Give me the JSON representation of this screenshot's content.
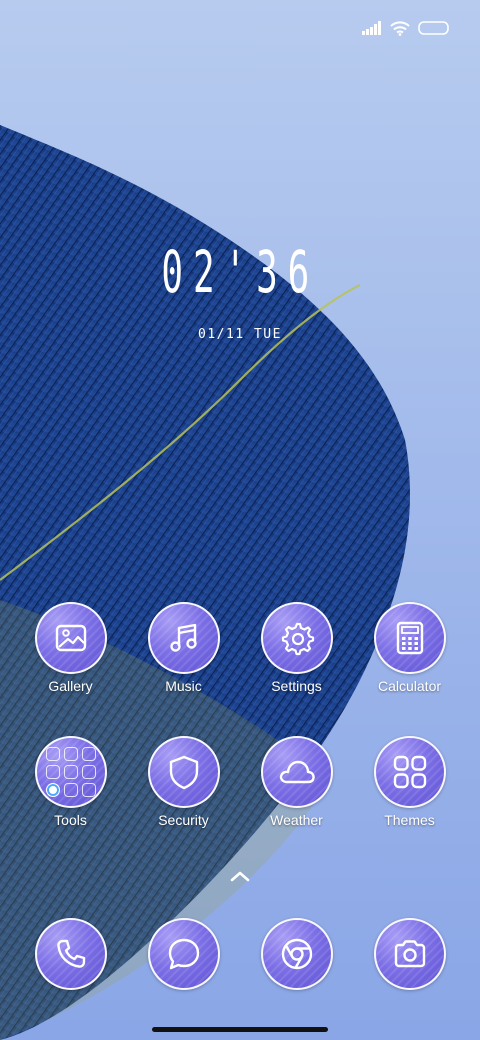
{
  "status_bar": {
    "icons": [
      "signal-icon",
      "wifi-icon",
      "battery-icon"
    ]
  },
  "lock": {
    "time": "02'36",
    "date": "01/11 TUE"
  },
  "apps": [
    {
      "label": "Gallery",
      "icon": "gallery-icon"
    },
    {
      "label": "Music",
      "icon": "music-icon"
    },
    {
      "label": "Settings",
      "icon": "gear-icon"
    },
    {
      "label": "Calculator",
      "icon": "calculator-icon"
    },
    {
      "label": "Tools",
      "icon": "folder-icon"
    },
    {
      "label": "Security",
      "icon": "shield-icon"
    },
    {
      "label": "Weather",
      "icon": "cloud-icon"
    },
    {
      "label": "Themes",
      "icon": "themes-icon"
    }
  ],
  "dock": [
    {
      "icon": "phone-icon"
    },
    {
      "icon": "message-icon"
    },
    {
      "icon": "browser-icon"
    },
    {
      "icon": "camera-icon"
    }
  ],
  "colors": {
    "background": "#a9c0ec",
    "feather": "#1e3f8f",
    "icon_bubble": "#7c6fe6"
  }
}
